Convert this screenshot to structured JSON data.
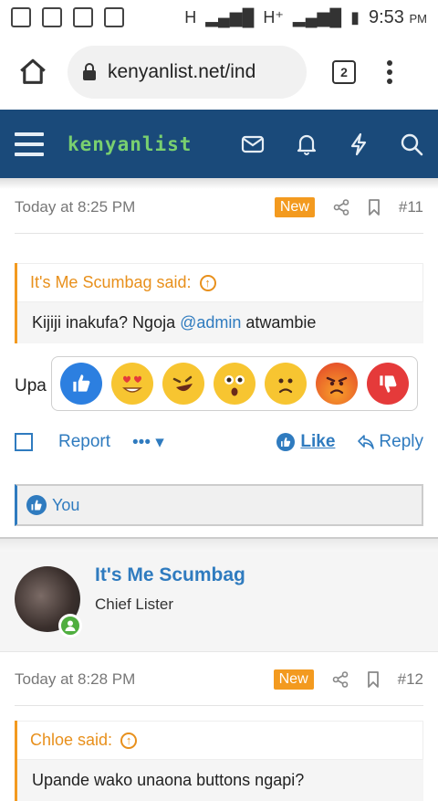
{
  "status": {
    "time": "9:53",
    "ampm": "PM",
    "network1": "H",
    "network2": "H⁺"
  },
  "browser": {
    "url": "kenyanlist.net/ind",
    "tab_count": "2"
  },
  "site": {
    "logo": "kenyanlist"
  },
  "post11": {
    "time": "Today at 8:25 PM",
    "badge": "New",
    "number": "#11",
    "quote_author": "It's Me Scumbag said:",
    "quote_text_before": "Kijiji inakufa? Ngoja ",
    "quote_mention": "@admin",
    "quote_text_after": " atwambie",
    "body_fragment": "Upa",
    "report": "Report",
    "more": "•••",
    "like": "Like",
    "reply": "Reply",
    "liked_by": "You"
  },
  "reactions": [
    "like-icon",
    "heart-eyes-icon",
    "laughing-icon",
    "shocked-icon",
    "confused-icon",
    "angry-icon",
    "dislike-icon"
  ],
  "author12": {
    "name": "It's Me Scumbag",
    "title": "Chief Lister"
  },
  "post12": {
    "time": "Today at 8:28 PM",
    "badge": "New",
    "number": "#12",
    "quote_author": "Chloe said:",
    "quote_text": "Upande wako unaona buttons ngapi?"
  },
  "colors": {
    "nav": "#1a4a7a",
    "accent": "#f39a1f",
    "link": "#2f7bbf",
    "logo": "#79d06f"
  }
}
